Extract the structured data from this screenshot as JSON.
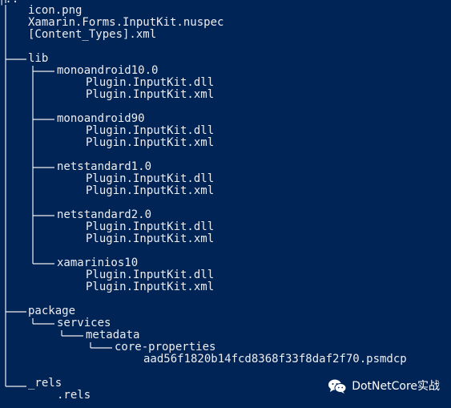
{
  "tree": {
    "top_fragment": "│..",
    "root_files": [
      "icon.png",
      "Xamarin.Forms.InputKit.nuspec",
      "[Content_Types].xml"
    ],
    "lib": {
      "label": "lib",
      "frameworks": [
        {
          "name": "monoandroid10.0",
          "files": [
            "Plugin.InputKit.dll",
            "Plugin.InputKit.xml"
          ]
        },
        {
          "name": "monoandroid90",
          "files": [
            "Plugin.InputKit.dll",
            "Plugin.InputKit.xml"
          ]
        },
        {
          "name": "netstandard1.0",
          "files": [
            "Plugin.InputKit.dll",
            "Plugin.InputKit.xml"
          ]
        },
        {
          "name": "netstandard2.0",
          "files": [
            "Plugin.InputKit.dll",
            "Plugin.InputKit.xml"
          ]
        },
        {
          "name": "xamarinios10",
          "files": [
            "Plugin.InputKit.dll",
            "Plugin.InputKit.xml"
          ]
        }
      ]
    },
    "package": {
      "label": "package",
      "services": "services",
      "metadata": "metadata",
      "core_properties": "core-properties",
      "psmdcp_file": "aad56f1820b14fcd8368f33f8daf2f70.psmdcp"
    },
    "rels": {
      "label": "_rels",
      "file": ".rels"
    }
  },
  "watermark": {
    "text": "DotNetCore实战",
    "icon": "wechat-icon"
  },
  "colors": {
    "background": "#012456",
    "foreground": "#eeedf0"
  }
}
